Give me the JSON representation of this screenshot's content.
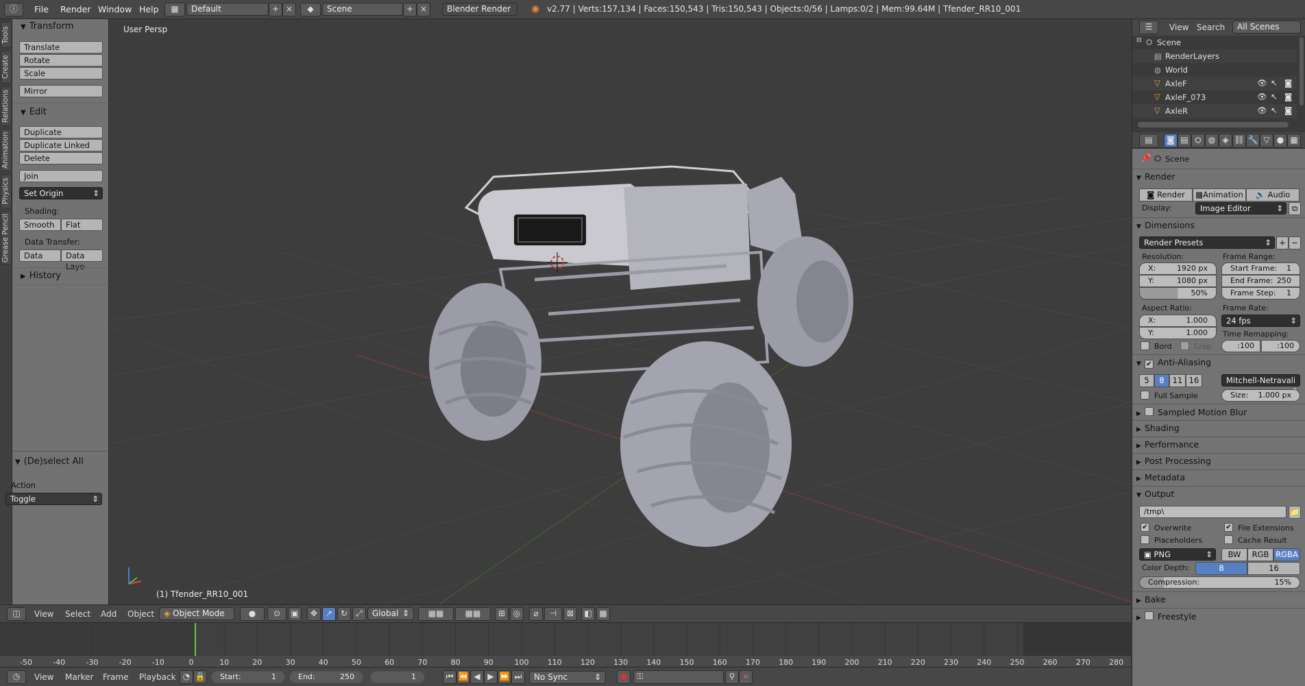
{
  "topbar": {
    "menus": [
      "File",
      "Render",
      "Window",
      "Help"
    ],
    "layout": "Default",
    "scene": "Scene",
    "engine": "Blender Render",
    "stats": "v2.77 | Verts:157,134 | Faces:150,543 | Tris:150,543 | Objects:0/56 | Lamps:0/2 | Mem:99.64M | Tfender_RR10_001"
  },
  "tabs": [
    "Tools",
    "Create",
    "Relations",
    "Animation",
    "Physics",
    "Grease Pencil"
  ],
  "toolshelf": {
    "transform_title": "Transform",
    "translate": "Translate",
    "rotate": "Rotate",
    "scale": "Scale",
    "mirror": "Mirror",
    "edit_title": "Edit",
    "duplicate": "Duplicate",
    "duplicate_linked": "Duplicate Linked",
    "delete": "Delete",
    "join": "Join",
    "set_origin": "Set Origin",
    "shading_label": "Shading:",
    "smooth": "Smooth",
    "flat": "Flat",
    "data_transfer_label": "Data Transfer:",
    "data": "Data",
    "data_layout": "Data Layo",
    "history_title": "History",
    "deselect_title": "(De)select All",
    "action_label": "Action",
    "action_value": "Toggle"
  },
  "viewport": {
    "view_label": "User Persp",
    "object_label": "(1) Tfender_RR10_001"
  },
  "viewheader": {
    "items": [
      "View",
      "Select",
      "Add",
      "Object"
    ],
    "mode": "Object Mode",
    "orientation": "Global"
  },
  "timeline": {
    "ticks": [
      "-50",
      "-40",
      "-30",
      "-20",
      "-10",
      "0",
      "10",
      "20",
      "30",
      "40",
      "50",
      "60",
      "70",
      "80",
      "90",
      "100",
      "110",
      "120",
      "130",
      "140",
      "150",
      "160",
      "170",
      "180",
      "190",
      "200",
      "210",
      "220",
      "230",
      "240",
      "250",
      "260",
      "270",
      "280"
    ],
    "current_frame": 1
  },
  "tlheader": {
    "items": [
      "View",
      "Marker",
      "Frame",
      "Playback"
    ],
    "start_label": "Start:",
    "start_value": "1",
    "end_label": "End:",
    "end_value": "250",
    "current": "1",
    "sync": "No Sync"
  },
  "outliner": {
    "view": "View",
    "search": "Search",
    "filter": "All Scenes",
    "rows": [
      "Scene",
      "RenderLayers",
      "World",
      "AxleF",
      "AxleF_073",
      "AxleR"
    ]
  },
  "props": {
    "scene": "Scene",
    "render_title": "Render",
    "render_btn": "Render",
    "animation_btn": "Animation",
    "audio_btn": "Audio",
    "display_label": "Display:",
    "display_value": "Image Editor",
    "dimensions_title": "Dimensions",
    "render_presets": "Render Presets",
    "resolution_label": "Resolution:",
    "res_x_label": "X:",
    "res_x": "1920 px",
    "res_y_label": "Y:",
    "res_y": "1080 px",
    "res_pct": "50%",
    "frame_range_label": "Frame Range:",
    "start_frame_label": "Start Frame:",
    "start_frame": "1",
    "end_frame_label": "End Frame:",
    "end_frame": "250",
    "frame_step_label": "Frame Step:",
    "frame_step": "1",
    "aspect_label": "Aspect Ratio:",
    "asp_x": "1.000",
    "asp_y": "1.000",
    "frame_rate_label": "Frame Rate:",
    "frame_rate": "24 fps",
    "remap_label": "Time Remapping:",
    "remap_old": ":100",
    "remap_new": ":100",
    "bord": "Bord",
    "crop": "Crop",
    "aa_title": "Anti-Aliasing",
    "aa_samples": [
      "5",
      "8",
      "11",
      "16"
    ],
    "aa_filter": "Mitchell-Netravali",
    "full_sample": "Full Sample",
    "size_label": "Size:",
    "size_value": "1.000 px",
    "motion_blur": "Sampled Motion Blur",
    "shading": "Shading",
    "performance": "Performance",
    "post_processing": "Post Processing",
    "metadata": "Metadata",
    "output_title": "Output",
    "output_path": "/tmp\\",
    "overwrite": "Overwrite",
    "file_ext": "File Extensions",
    "placeholders": "Placeholders",
    "cache_result": "Cache Result",
    "format": "PNG",
    "bw": "BW",
    "rgb": "RGB",
    "rgba": "RGBA",
    "color_depth_label": "Color Depth:",
    "depth_8": "8",
    "depth_16": "16",
    "compression_label": "Compression:",
    "compression": "15%",
    "bake": "Bake",
    "freestyle": "Freestyle"
  }
}
